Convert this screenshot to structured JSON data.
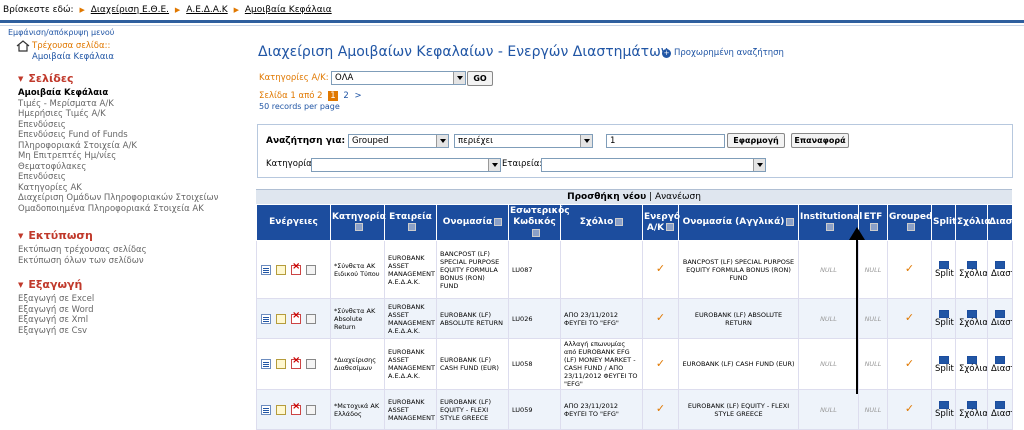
{
  "breadcrumb": {
    "label": "Βρίσκεστε εδώ:",
    "items": [
      "Διαχείριση Ε.Θ.Ε.",
      "Α.Ε.Δ.Α.Κ",
      "Αμοιβαία Κεφάλαια"
    ]
  },
  "sidebar": {
    "toggle": "Εμφάνιση/απόκρυψη μενού",
    "current_label": "Τρέχουσα σελίδα::",
    "current_value": "Αμοιβαία Κεφάλαια",
    "sections": [
      {
        "title": "Σελίδες",
        "items": [
          "Αμοιβαία Κεφάλαια",
          "Τιμές - Μερίσματα Α/Κ",
          "Ημερήσιες Τιμές Α/Κ",
          "Επενδύσεις",
          "Επενδύσεις Fund of Funds",
          "Πληροφοριακά Στοιχεία Α/Κ",
          "Μη Επιτρεπτές Ημ/νίες",
          "Θεματοφύλακες",
          "Επενδύσεις",
          "Κατηγορίες ΑΚ",
          "Διαχείριση Ομάδων Πληροφοριακών Στοιχείων",
          "Ομαδοποιημένα Πληροφοριακά Στοιχεία ΑΚ"
        ]
      },
      {
        "title": "Εκτύπωση",
        "items": [
          "Εκτύπωση τρέχουσας σελίδας",
          "Εκτύπωση όλων των σελίδων"
        ]
      },
      {
        "title": "Εξαγωγή",
        "items": [
          "Εξαγωγή σε Excel",
          "Εξαγωγή σε Word",
          "Εξαγωγή σε Xml",
          "Εξαγωγή σε Csv"
        ]
      }
    ]
  },
  "main": {
    "title": "Διαχείριση Αμοιβαίων Κεφαλαίων - Ενεργών Διαστημάτων",
    "advanced_search": "Προχωρημένη αναζήτηση",
    "category_label": "Κατηγορίες Α/Κ:",
    "category_value": "ΟΛΑ",
    "go_label": "GO",
    "pager": {
      "text": "Σελίδα 1 από 2",
      "current": "1",
      "next": "2",
      "arrow": ">"
    },
    "per_page": "50 records per page",
    "search": {
      "label": "Αναζήτηση για:",
      "field": "Grouped",
      "operator": "περιέχει",
      "value": "1",
      "apply": "Εφαρμογή",
      "reset": "Επαναφορά",
      "category_label": "Κατηγορία:",
      "company_label": "Εταιρεία:"
    },
    "grid_top": {
      "add": "Προσθήκη νέου",
      "sep": "|",
      "refresh": "Ανανέωση"
    },
    "columns": [
      "Ενέργειες",
      "Κατηγορία",
      "Εταιρεία",
      "Ονομασία",
      "Εσωτερικός Κωδικός",
      "Σχόλιο",
      "Ενεργό Α/Κ",
      "Ονομασία (Αγγλικά)",
      "Institutional",
      "ETF",
      "Grouped",
      "Split",
      "Σχόλια",
      "Διαστήματα"
    ],
    "rows": [
      {
        "category": "*Σύνθετα ΑΚ Ειδικού Τύπου",
        "company": "EUROBANK ASSET MANAGEMENT Α.Ε.Δ.Α.Κ.",
        "name": "BANCPOST (LF) SPECIAL PURPOSE EQUITY FORMULA BONUS (RON) FUND",
        "code": "LU087",
        "comment": "",
        "active": "✓",
        "name_en": "BANCPOST (LF) SPECIAL PURPOSE EQUITY FORMULA BONUS (RON) FUND",
        "institutional": "NULL",
        "etf": "NULL",
        "grouped": "✓",
        "split": "Split",
        "notes": "Σχόλια",
        "intervals": "Διαστήματα"
      },
      {
        "category": "*Σύνθετα ΑΚ Absolute Return",
        "company": "EUROBANK ASSET MANAGEMENT Α.Ε.Δ.Α.Κ.",
        "name": "EUROBANK (LF) ABSOLUTE RETURN",
        "code": "LU026",
        "comment": "ΑΠΟ 23/11/2012 ΦΕΥΓΕΙ ΤΟ \"EFG\"",
        "active": "✓",
        "name_en": "EUROBANK (LF) ABSOLUTE RETURN",
        "institutional": "NULL",
        "etf": "NULL",
        "grouped": "✓",
        "split": "Split",
        "notes": "Σχόλια",
        "intervals": "Διαστήματα"
      },
      {
        "category": "*Διαχείρισης Διαθεσίμων",
        "company": "EUROBANK ASSET MANAGEMENT Α.Ε.Δ.Α.Κ.",
        "name": "EUROBANK (LF) CASH FUND (EUR)",
        "code": "LU058",
        "comment": "Αλλαγή επωνυμίας από EUROBANK EFG (LF) MONEY MARKET - CASH FUND / ΑΠΟ 23/11/2012 ΦΕΥΓΕΙ ΤΟ \"EFG\"",
        "active": "✓",
        "name_en": "EUROBANK (LF) CASH FUND (EUR)",
        "institutional": "NULL",
        "etf": "NULL",
        "grouped": "✓",
        "split": "Split",
        "notes": "Σχόλια",
        "intervals": "Διαστήματα"
      },
      {
        "category": "*Μετοχικά ΑΚ Ελλάδος",
        "company": "EUROBANK ASSET MANAGEMENT",
        "name": "EUROBANK (LF) EQUITY - FLEXI STYLE GREECE",
        "code": "LU059",
        "comment": "ΑΠΟ 23/11/2012 ΦΕΥΓΕΙ ΤΟ \"EFG\"",
        "active": "✓",
        "name_en": "EUROBANK (LF) EQUITY - FLEXI STYLE GREECE",
        "institutional": "NULL",
        "etf": "NULL",
        "grouped": "✓",
        "split": "Split",
        "notes": "Σχόλια",
        "intervals": "Διαστήματα"
      }
    ]
  }
}
